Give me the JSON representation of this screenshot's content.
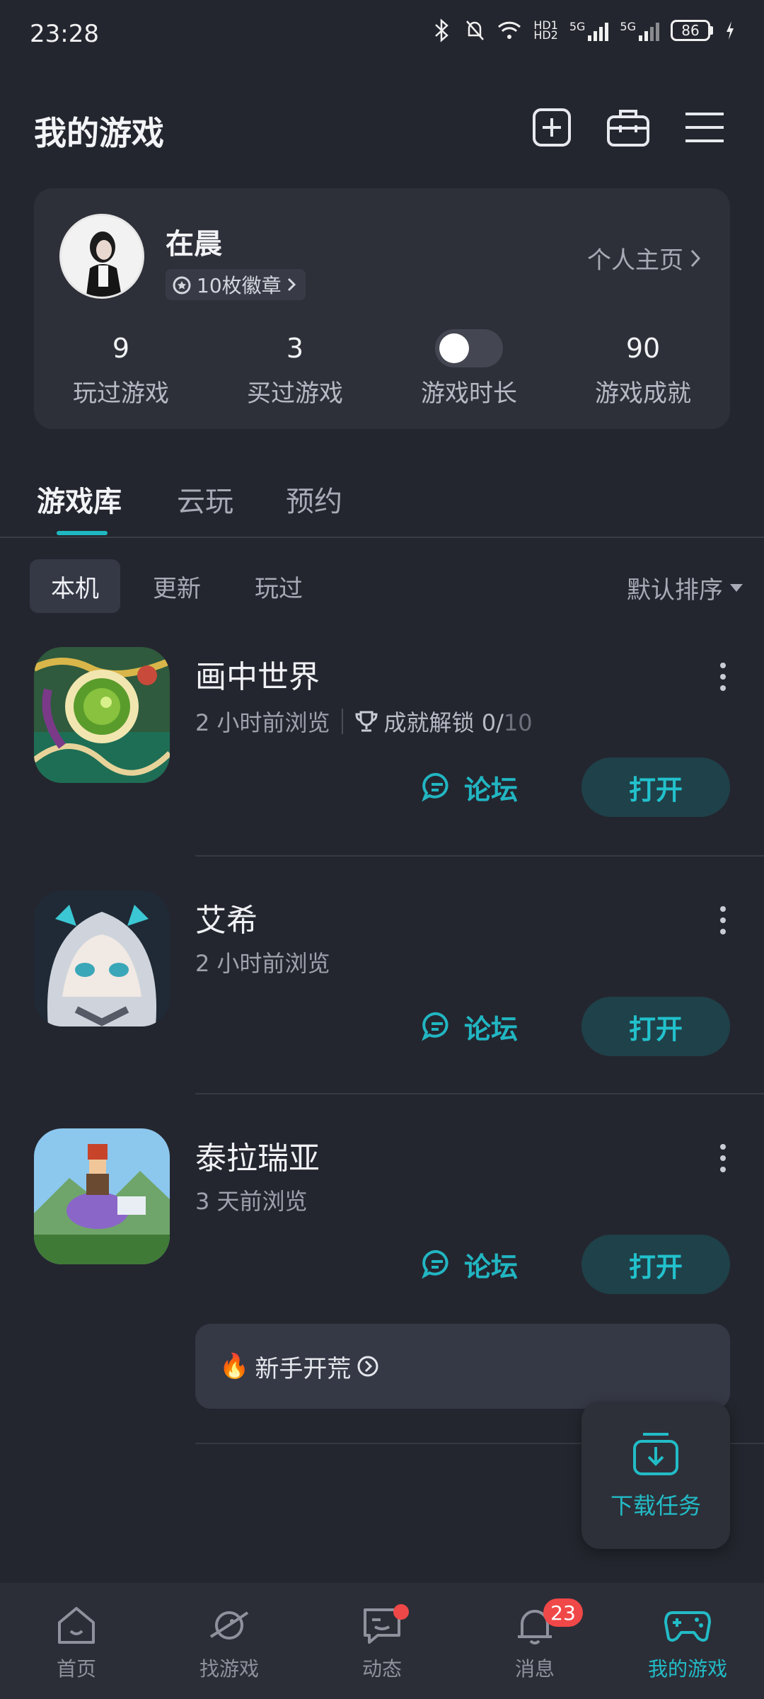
{
  "status_bar": {
    "time": "23:28",
    "battery": "86",
    "network_labels": [
      "HD1",
      "HD2",
      "5G",
      "5G"
    ]
  },
  "header": {
    "title": "我的游戏",
    "icons": [
      "add-square-icon",
      "toolbox-icon",
      "menu-icon"
    ]
  },
  "profile": {
    "username": "在晨",
    "badges": "10枚徽章",
    "homepage_link": "个人主页",
    "stats": [
      {
        "value": "9",
        "label": "玩过游戏"
      },
      {
        "value": "3",
        "label": "买过游戏"
      },
      {
        "value": "",
        "label": "游戏时长",
        "toggle_on": false
      },
      {
        "value": "90",
        "label": "游戏成就"
      }
    ]
  },
  "tabs": [
    {
      "label": "游戏库",
      "active": true
    },
    {
      "label": "云玩",
      "active": false
    },
    {
      "label": "预约",
      "active": false
    }
  ],
  "filters": {
    "chips": [
      {
        "label": "本机",
        "active": true
      },
      {
        "label": "更新",
        "active": false
      },
      {
        "label": "玩过",
        "active": false
      }
    ],
    "sort_label": "默认排序"
  },
  "games": [
    {
      "name": "画中世界",
      "viewed": "2 小时前浏览",
      "achievement_label": "成就解锁",
      "achievement_progress": "0/",
      "achievement_total": "10",
      "forum_label": "论坛",
      "open_label": "打开"
    },
    {
      "name": "艾希",
      "viewed": "2 小时前浏览",
      "forum_label": "论坛",
      "open_label": "打开"
    },
    {
      "name": "泰拉瑞亚",
      "viewed": "3 天前浏览",
      "forum_label": "论坛",
      "open_label": "打开"
    }
  ],
  "newbie": {
    "label": "新手开荒",
    "emoji": "🔥"
  },
  "download_task": {
    "label": "下载任务"
  },
  "bottom_nav": [
    {
      "label": "首页",
      "icon": "home-icon",
      "active": false
    },
    {
      "label": "找游戏",
      "icon": "planet-icon",
      "active": false
    },
    {
      "label": "动态",
      "icon": "chat-icon",
      "active": false,
      "dot": true
    },
    {
      "label": "消息",
      "icon": "bell-icon",
      "active": false,
      "badge": "23"
    },
    {
      "label": "我的游戏",
      "icon": "gamepad-icon",
      "active": true
    }
  ],
  "colors": {
    "background": "#24262f",
    "card": "#2e3039",
    "accent": "#22bcc7",
    "badge_red": "#f04848"
  }
}
